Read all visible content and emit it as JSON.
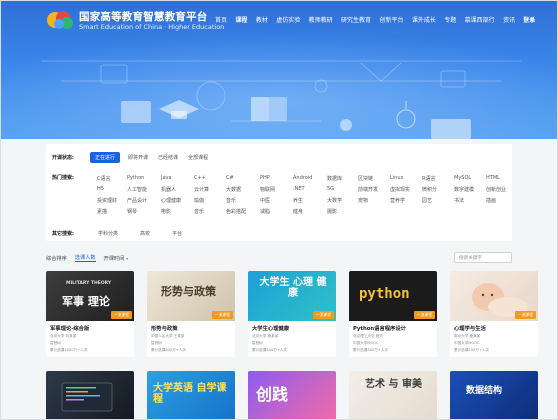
{
  "header": {
    "logo_title": "国家高等教育智慧教育平台",
    "logo_sub": "Smart Education of China · Higher Education",
    "nav": [
      "首页",
      "课程",
      "教材",
      "虚仿实验",
      "教师教研",
      "研究生教育",
      "创新平台",
      "课外成长",
      "专题",
      "慕课西部行",
      "资讯",
      "联系"
    ],
    "active_nav_index": 1,
    "login": "登录"
  },
  "filters": {
    "status_label": "开课状态:",
    "status_options": [
      "正在进行",
      "即将开课",
      "已经结课",
      "全部课程"
    ],
    "hot_label": "热门搜索:",
    "hot_rows": [
      [
        "C语言",
        "Python",
        "Java",
        "C++",
        "C#",
        "PHP",
        "Android",
        "数据库",
        "区块链",
        "Linux",
        "R语言",
        "MySQL",
        "HTML"
      ],
      [
        "H5",
        "人工智能",
        "机器人",
        "云计算",
        "大数据",
        "物联网",
        ".NET",
        "5G",
        "前端开发",
        "虚拟现实",
        "微积分",
        "数字建模",
        "创新创业"
      ],
      [
        "投资理财",
        "产品设计",
        "心理健康",
        "瑜伽",
        "音乐",
        "中医",
        "养生",
        "大数学",
        "宠物",
        "营养学",
        "园艺",
        "书法",
        "插画"
      ],
      [
        "素描",
        "钢琴",
        "电影",
        "音乐",
        "色彩搭配",
        "减脂",
        "健身",
        "摄影"
      ]
    ],
    "other_label": "其它搜索:",
    "other_options": [
      "学科分类",
      "高校",
      "平台"
    ]
  },
  "sortbar": {
    "items": [
      "综合排序",
      "选课人数",
      "开课时间"
    ],
    "selected_index": 1,
    "search_placeholder": "搜索关键字"
  },
  "badge_text": "一流课程",
  "cards": [
    {
      "title": "军事理论-综合版",
      "school": "北京大学 刘某某",
      "tag": "智慧树",
      "count": "累计选课1000万+人次",
      "overlay_top": "MILITARY THEORY",
      "overlay": "军事 理论"
    },
    {
      "title": "形势与政策",
      "school": "中国人民大学 王某某",
      "tag": "智慧树",
      "count": "累计选课800万+人次",
      "overlay": "形势与政策"
    },
    {
      "title": "大学生心理健康",
      "school": "北京大学 杨某某",
      "tag": "智慧树",
      "count": "累计选课400万+人次",
      "overlay": "大学生 心理 健康"
    },
    {
      "title": "Python语言程序设计",
      "school": "北京理工大学 嵩天",
      "tag": "中国大学MOOC",
      "count": "累计选课300万+人次",
      "overlay": "python"
    },
    {
      "title": "心理学与生活",
      "school": "南京大学 桑某某",
      "tag": "中国大学MOOC",
      "count": "累计选课200万+人次",
      "overlay": ""
    }
  ],
  "cards_row2": [
    {
      "overlay": ""
    },
    {
      "overlay": "大学英语 自学课程"
    },
    {
      "overlay": "创践"
    },
    {
      "overlay": "艺术 与 审美"
    },
    {
      "overlay": "数据结构"
    }
  ]
}
